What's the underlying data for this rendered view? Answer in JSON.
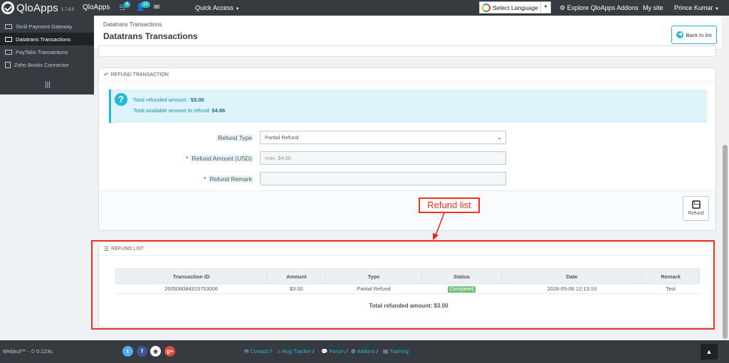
{
  "topbar": {
    "app_name": "QloApps",
    "version": "1.7.0.0",
    "shop_name": "QloApps",
    "orders_count": "6",
    "customers_count": "12",
    "quick_access": "Quick Access",
    "select_language": "Select Language",
    "explore_addons": "Explore QloApps Addons",
    "my_site": "My site",
    "user_name": "Prince Kumar"
  },
  "sidebar": {
    "items": [
      {
        "label": "Skrill Payment Gateway",
        "icon": "card-icon"
      },
      {
        "label": "Datatrans Transactions",
        "icon": "card-icon",
        "active": true
      },
      {
        "label": "PayTabs Transactions",
        "icon": "card-icon"
      },
      {
        "label": "Zoho Books Connector",
        "icon": "file-icon"
      }
    ]
  },
  "header": {
    "breadcrumb": "Datatrans Transactions",
    "title": "Datatrans Transactions",
    "back_label": "Back to list"
  },
  "refund_transaction": {
    "heading": "Refund Transaction",
    "total_refunded_label": "Total refunded amount :",
    "total_refunded_value": "$3.00",
    "available_label": "Total available amount to refund:",
    "available_value": "$4.86",
    "type_label": "Refund Type",
    "type_value": "Partial Refund",
    "amount_label": "Refund Amount (USD)",
    "amount_placeholder": "max. $4.86",
    "remark_label": "Refund Remark",
    "refund_button": "Refund"
  },
  "annotation": {
    "label": "Refund list",
    "color": "#e32222"
  },
  "refund_list": {
    "heading": "Refund List",
    "columns": [
      "Transaction ID",
      "Amount",
      "Type",
      "Status",
      "Date",
      "Remark"
    ],
    "rows": [
      {
        "transaction_id": "260506084315753006",
        "amount": "$3.00",
        "type": "Partial Refund",
        "status": "Completed",
        "date": "2026-05-06 12:13:16",
        "remark": "Test"
      }
    ],
    "total": "Total refunded amount: $3.00"
  },
  "footer": {
    "brand": "Webkul™ -",
    "load_time": "0.123s",
    "links": [
      "Contact",
      "Bug Tracker",
      "Forum",
      "Addons",
      "Training"
    ],
    "social": [
      "twitter-icon",
      "facebook-icon",
      "github-icon",
      "google-plus-icon"
    ]
  },
  "colors": {
    "accent": "#25b9d7",
    "dark": "#363a41",
    "success": "#72c279"
  }
}
